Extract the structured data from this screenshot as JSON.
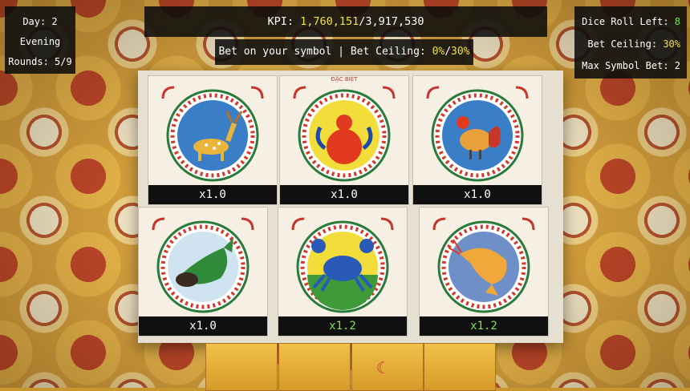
{
  "hud": {
    "day_label": "Day: 2",
    "time_of_day": "Evening",
    "rounds_label": "Rounds: 5/9",
    "kpi_prefix": "KPI: ",
    "kpi_current": "1,760,151",
    "kpi_separator": "/",
    "kpi_target": "3,917,530",
    "bet_prompt": "Bet on your symbol | Bet Ceiling: ",
    "bet_current": "0%",
    "bet_separator": "/",
    "bet_ceiling": "30%",
    "dice_roll_label": "Dice Roll Left: ",
    "dice_roll_value": "8",
    "bet_ceiling_label": "Bet Ceiling: ",
    "bet_ceiling_value": "30%",
    "max_symbol_bet_label": "Max Symbol Bet: ",
    "max_symbol_bet_value": "2"
  },
  "board": {
    "cards": [
      {
        "symbol": "deer",
        "multiplier": "x1.0",
        "highlight": false
      },
      {
        "symbol": "gourd",
        "banner": "ĐẶC BIỆT",
        "multiplier": "x1.0",
        "highlight": false
      },
      {
        "symbol": "rooster",
        "multiplier": "x1.0",
        "highlight": false
      },
      {
        "symbol": "fish",
        "multiplier": "x1.0",
        "highlight": false
      },
      {
        "symbol": "crab",
        "multiplier": "x1.2",
        "highlight": true
      },
      {
        "symbol": "shrimp",
        "multiplier": "x1.2",
        "highlight": true
      }
    ]
  },
  "colors": {
    "kpi_highlight": "#f1e23c",
    "positive": "#7de24e",
    "panel_bg": "#0c0c0c"
  }
}
